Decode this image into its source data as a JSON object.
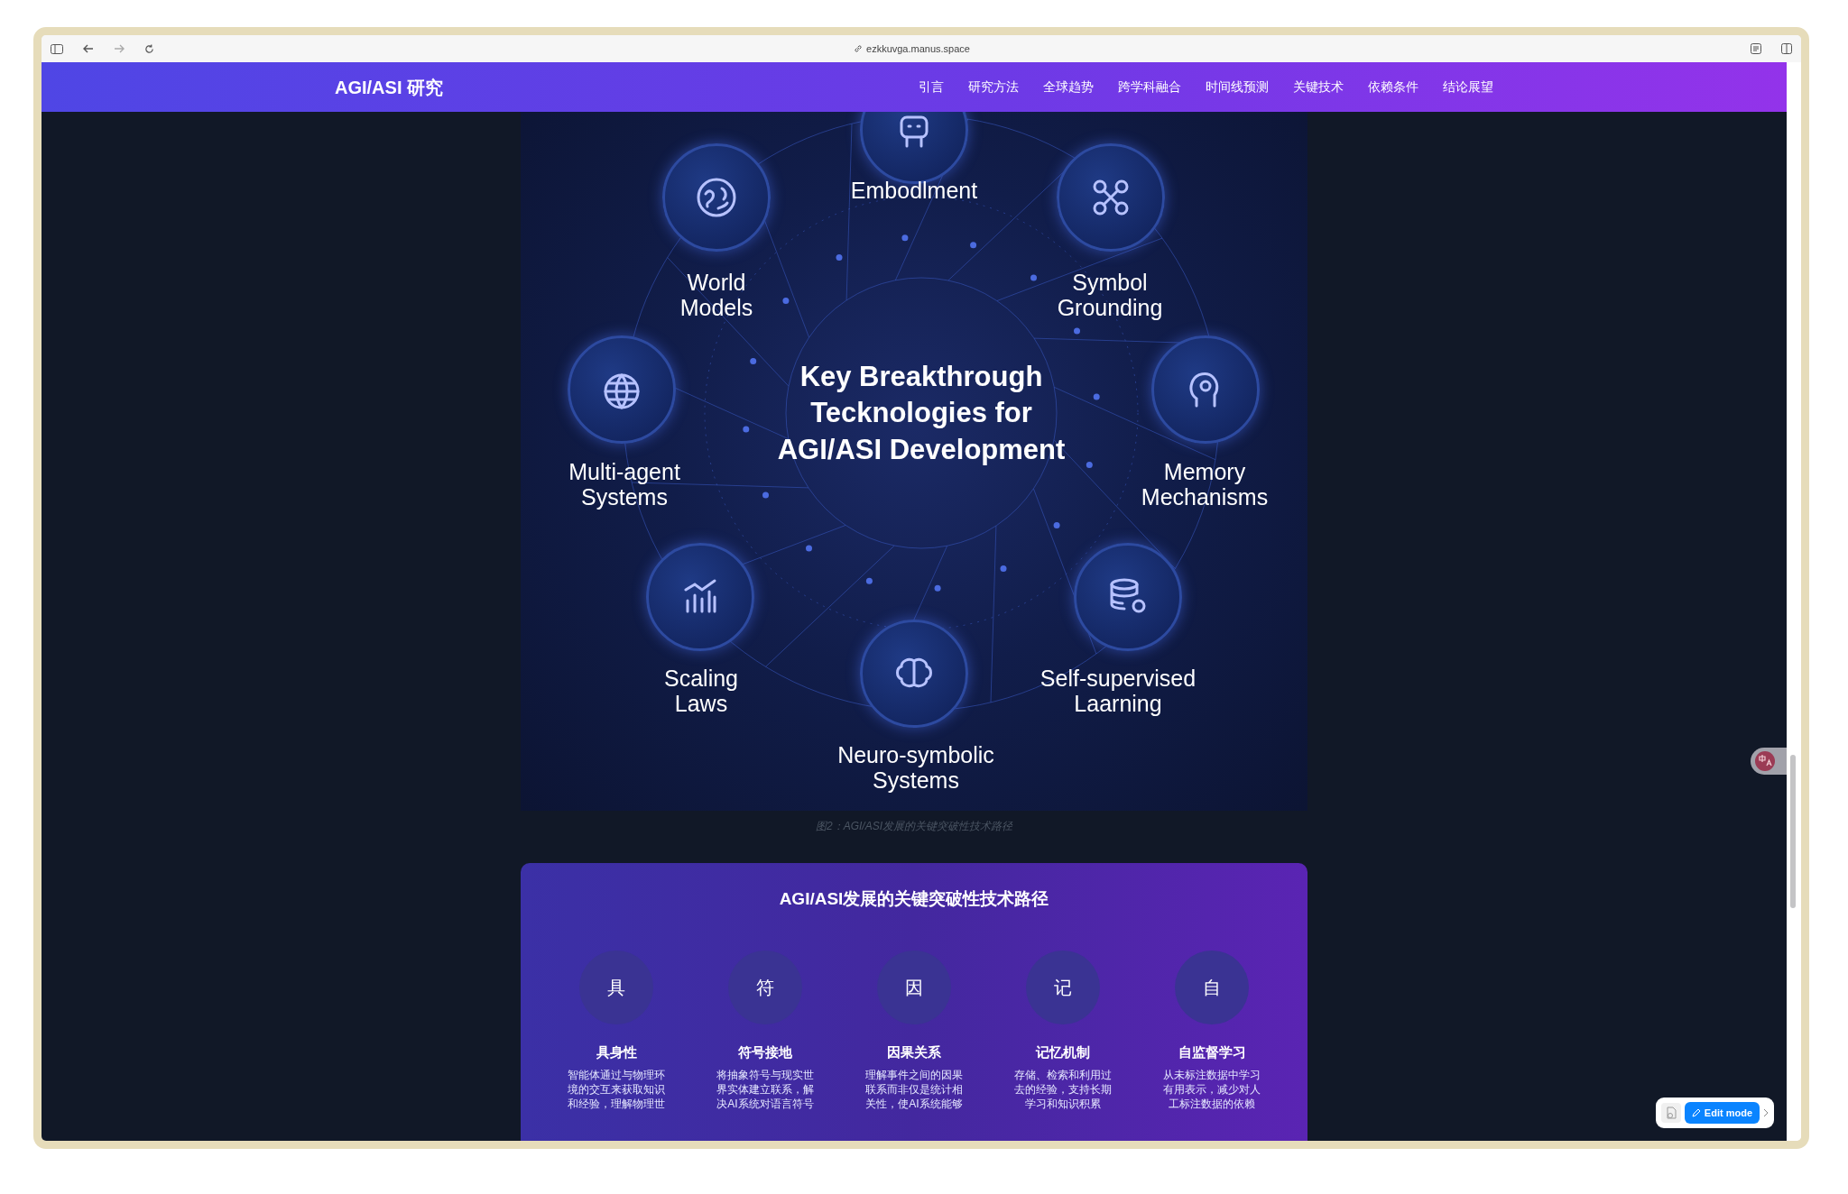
{
  "browser": {
    "url": "ezkkuvga.manus.space"
  },
  "navbar": {
    "brand": "AGI/ASI 研究",
    "links": [
      {
        "label": "引言"
      },
      {
        "label": "研究方法"
      },
      {
        "label": "全球趋势"
      },
      {
        "label": "跨学科融合"
      },
      {
        "label": "时间线预测"
      },
      {
        "label": "关键技术"
      },
      {
        "label": "依赖条件"
      },
      {
        "label": "结论展望"
      }
    ]
  },
  "figure": {
    "title": "Key Breakthrough\nTecknologies for\nAGI/ASI Development",
    "nodes": [
      {
        "label": "Embodlment"
      },
      {
        "label": "World\nModels"
      },
      {
        "label": "Symbol\nGrounding"
      },
      {
        "label": "Multi-agent\nSystems"
      },
      {
        "label": "Memory\nMechanisms"
      },
      {
        "label": "Scaling\nLaws"
      },
      {
        "label": "Neuro-symbolic\nSystems"
      },
      {
        "label": "Self-supervised\nLaarning"
      }
    ]
  },
  "caption": "图2：AGI/ASI发展的关键突破性技术路径",
  "path_card": {
    "title": "AGI/ASI发展的关键突破性技术路径",
    "items": [
      {
        "glyph": "具",
        "title": "具身性",
        "description": "智能体通过与物理环境的交互来获取知识和经验，理解物理世"
      },
      {
        "glyph": "符",
        "title": "符号接地",
        "description": "将抽象符号与现实世界实体建立联系，解决AI系统对语言符号"
      },
      {
        "glyph": "因",
        "title": "因果关系",
        "description": "理解事件之间的因果联系而非仅是统计相关性，使AI系统能够"
      },
      {
        "glyph": "记",
        "title": "记忆机制",
        "description": "存储、检索和利用过去的经验，支持长期学习和知识积累"
      },
      {
        "glyph": "自",
        "title": "自监督学习",
        "description": "从未标注数据中学习有用表示，减少对人工标注数据的依赖"
      }
    ]
  },
  "edit_mode": {
    "label": "Edit mode"
  }
}
